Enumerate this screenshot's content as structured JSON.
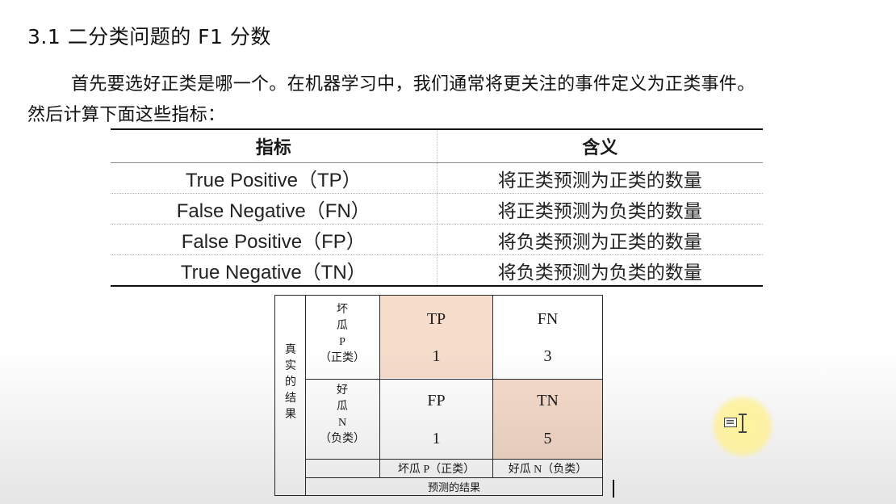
{
  "section": {
    "heading": "3.1 二分类问题的 F1 分数",
    "paragraph_line1": "首先要选好正类是哪一个。在机器学习中，我们通常将更关注的事件定义为正类事件。",
    "paragraph_line2": "然后计算下面这些指标："
  },
  "metrics_table": {
    "headers": [
      "指标",
      "含义"
    ],
    "rows": [
      [
        "True Positive（TP）",
        "将正类预测为正类的数量"
      ],
      [
        "False Negative（FN）",
        "将正类预测为负类的数量"
      ],
      [
        "False Positive（FP）",
        "将负类预测为正类的数量"
      ],
      [
        "True Negative（TN）",
        "将负类预测为负类的数量"
      ]
    ]
  },
  "confusion_matrix": {
    "actual_axis_label": [
      "真",
      "实",
      "的",
      "结",
      "果"
    ],
    "row_labels": [
      [
        "坏",
        "瓜",
        "P",
        "（正类）"
      ],
      [
        "好",
        "瓜",
        "N",
        "（负类）"
      ]
    ],
    "cells": [
      {
        "label": "TP",
        "value": "1"
      },
      {
        "label": "FN",
        "value": "3"
      },
      {
        "label": "FP",
        "value": "1"
      },
      {
        "label": "TN",
        "value": "5"
      }
    ],
    "column_labels": [
      "坏瓜 P（正类）",
      "好瓜 N（负类）"
    ],
    "predicted_axis_label": "预测的结果",
    "highlight_color": "#f6dccb",
    "line_color": "#2a2a2a"
  },
  "cursor": {
    "icon": "ibeam-cursor-icon",
    "halo_color": "#fff3a0"
  }
}
